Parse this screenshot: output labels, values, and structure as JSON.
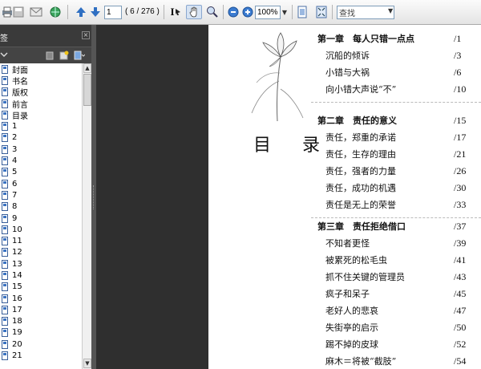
{
  "toolbar": {
    "page_current": "1",
    "page_total": "( 6 / 276 )",
    "select_tool_label": "I",
    "zoom_value": "100%",
    "search_placeholder": "查找"
  },
  "bookmarks": [
    "封面",
    "书名",
    "版权",
    "前言",
    "目录",
    "1",
    "2",
    "3",
    "4",
    "5",
    "6",
    "7",
    "8",
    "9",
    "10",
    "11",
    "12",
    "13",
    "14",
    "15",
    "16",
    "17",
    "18",
    "19",
    "20",
    "21"
  ],
  "page": {
    "toc_title": "目 录",
    "chapters": [
      {
        "title": "第一章　每人只错一点点",
        "page": "/1",
        "sections": [
          {
            "title": "沉船的倾诉",
            "page": "/3"
          },
          {
            "title": "小错与大祸",
            "page": "/6"
          },
          {
            "title": "向小错大声说“不”",
            "page": "/10"
          }
        ]
      },
      {
        "title": "第二章　责任的意义",
        "page": "/15",
        "sections": [
          {
            "title": "责任，郑重的承诺",
            "page": "/17"
          },
          {
            "title": "责任，生存的理由",
            "page": "/21"
          },
          {
            "title": "责任，强者的力量",
            "page": "/26"
          },
          {
            "title": "责任，成功的机遇",
            "page": "/30"
          },
          {
            "title": "责任是无上的荣誉",
            "page": "/33"
          }
        ]
      },
      {
        "title": "第三章　责任拒绝借口",
        "page": "/37",
        "sections": [
          {
            "title": "不知者更怪",
            "page": "/39"
          },
          {
            "title": "被累死的松毛虫",
            "page": "/41"
          },
          {
            "title": "抓不住关键的管理员",
            "page": "/43"
          },
          {
            "title": "疯子和呆子",
            "page": "/45"
          },
          {
            "title": "老好人的悲哀",
            "page": "/47"
          },
          {
            "title": "失街亭的启示",
            "page": "/50"
          },
          {
            "title": "踢不掉的皮球",
            "page": "/52"
          },
          {
            "title": "麻木＝将被“截肢”",
            "page": "/54"
          }
        ]
      }
    ]
  }
}
